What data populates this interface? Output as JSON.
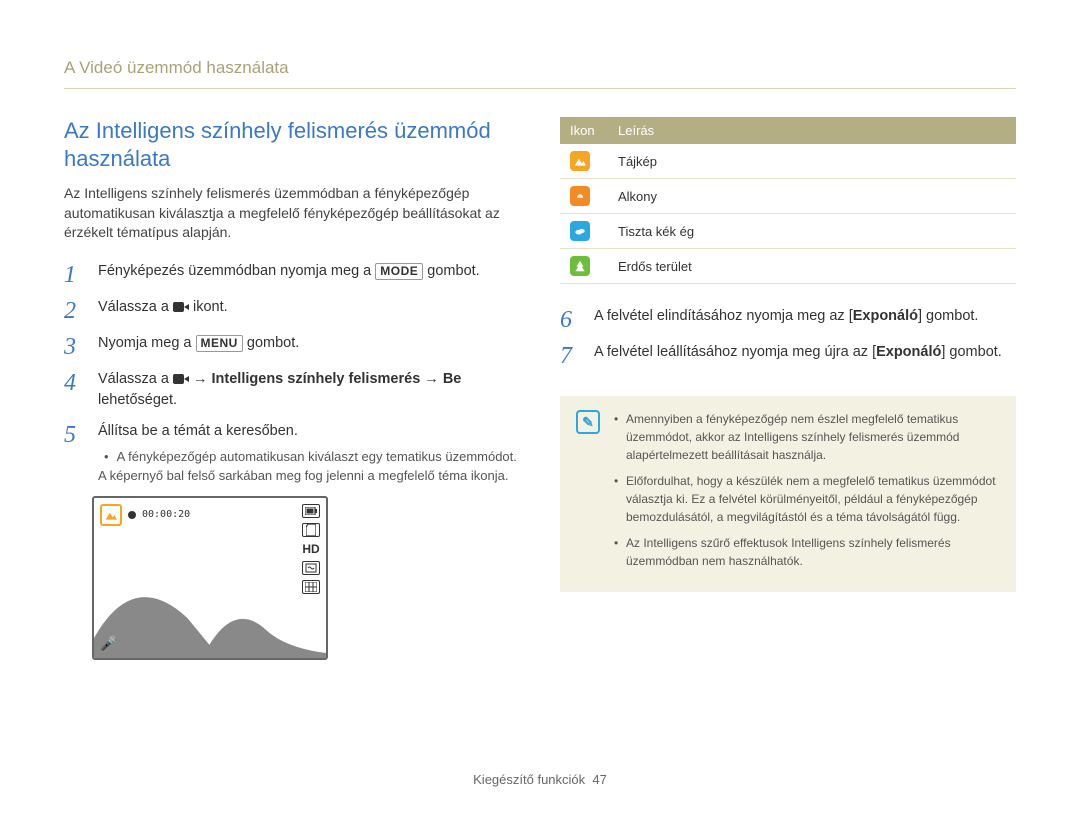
{
  "doc_title": "A Videó üzemmód használata",
  "h2": "Az Intelligens színhely felismerés üzemmód használata",
  "intro": "Az Intelligens színhely felismerés üzemmódban a fényképezőgép automatikusan kiválasztja a megfelelő fényképezőgép beállításokat az érzékelt tématípus alapján.",
  "steps_left": {
    "s1_a": "Fényképezés üzemmódban nyomja meg a ",
    "s1_btn": "MODE",
    "s1_b": " gombot.",
    "s2_a": "Válassza a ",
    "s2_b": " ikont.",
    "s3_a": "Nyomja meg a ",
    "s3_btn": "MENU",
    "s3_b": " gombot.",
    "s4_a": "Válassza a ",
    "s4_arrow1": " → ",
    "s4_bold1": "Intelligens színhely felismerés",
    "s4_arrow2": " → ",
    "s4_bold2": "Be",
    "s4_b": " lehetőséget.",
    "s5": "Állítsa be a témát a keresőben.",
    "s5_sub": "A fényképezőgép automatikusan kiválaszt egy tematikus üzemmódot. A képernyő bal felső sarkában meg fog jelenni a megfelelő téma ikonja."
  },
  "camera_preview": {
    "timer": "00:00:20",
    "hd_label": "HD"
  },
  "icon_table": {
    "th_icon": "Ikon",
    "th_desc": "Leírás",
    "rows": [
      {
        "label": "Tájkép"
      },
      {
        "label": "Alkony"
      },
      {
        "label": "Tiszta kék ég"
      },
      {
        "label": "Erdős terület"
      }
    ]
  },
  "steps_right": {
    "s6_a": "A felvétel elindításához nyomja meg az [",
    "s6_bold": "Exponáló",
    "s6_b": "] gombot.",
    "s7_a": "A felvétel leállításához nyomja meg újra az [",
    "s7_bold": "Exponáló",
    "s7_b": "] gombot."
  },
  "notes": {
    "n1": "Amennyiben a fényképezőgép nem észlel megfelelő tematikus üzemmódot, akkor az Intelligens színhely felismerés üzemmód alapértelmezett beállításait használja.",
    "n2": "Előfordulhat, hogy a készülék nem a megfelelő tematikus üzemmódot választja ki. Ez a felvétel körülményeitől, például a fényképezőgép bemozdulásától, a megvilágítástól és a téma távolságától függ.",
    "n3": "Az Intelligens szűrő effektusok Intelligens színhely felismerés üzemmódban nem használhatók."
  },
  "footer_a": "Kiegészítő funkciók",
  "footer_b": "47"
}
